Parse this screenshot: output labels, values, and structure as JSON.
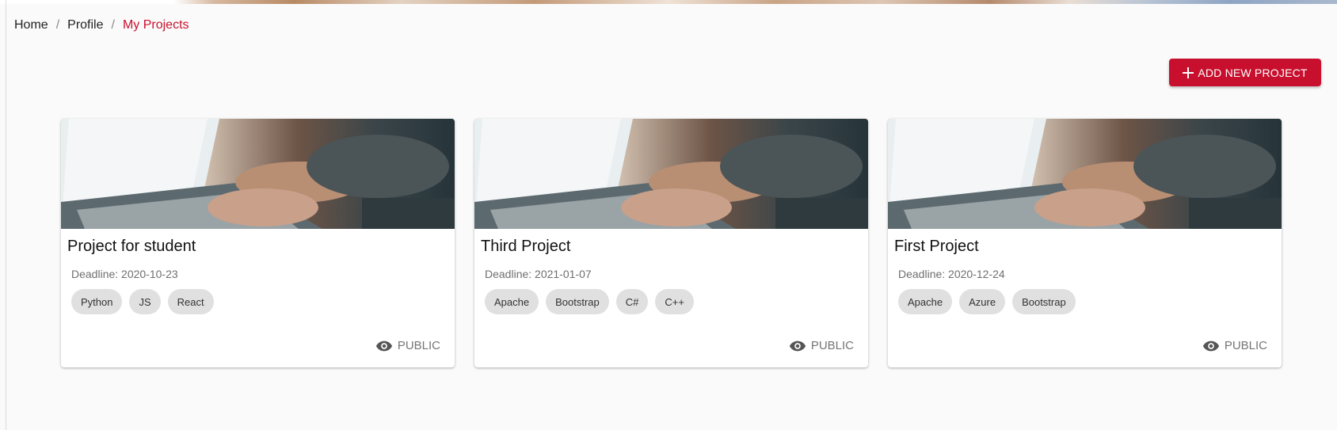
{
  "breadcrumb": {
    "home": "Home",
    "separator": "/",
    "profile": "Profile",
    "current": "My Projects"
  },
  "toolbar": {
    "add_label": "ADD NEW PROJECT",
    "add_icon": "plus-icon"
  },
  "colors": {
    "accent": "#c8102e",
    "chip_bg": "#e0e0e0",
    "page_bg": "#fafafa"
  },
  "projects": [
    {
      "title": "Project for student",
      "deadline": "Deadline: 2020-10-23",
      "tags": [
        "Python",
        "JS",
        "React"
      ],
      "visibility": "PUBLIC",
      "visibility_icon": "eye-icon"
    },
    {
      "title": "Third Project",
      "deadline": "Deadline: 2021-01-07",
      "tags": [
        "Apache",
        "Bootstrap",
        "C#",
        "C++"
      ],
      "visibility": "PUBLIC",
      "visibility_icon": "eye-icon"
    },
    {
      "title": "First Project",
      "deadline": "Deadline: 2020-12-24",
      "tags": [
        "Apache",
        "Azure",
        "Bootstrap"
      ],
      "visibility": "PUBLIC",
      "visibility_icon": "eye-icon"
    }
  ]
}
